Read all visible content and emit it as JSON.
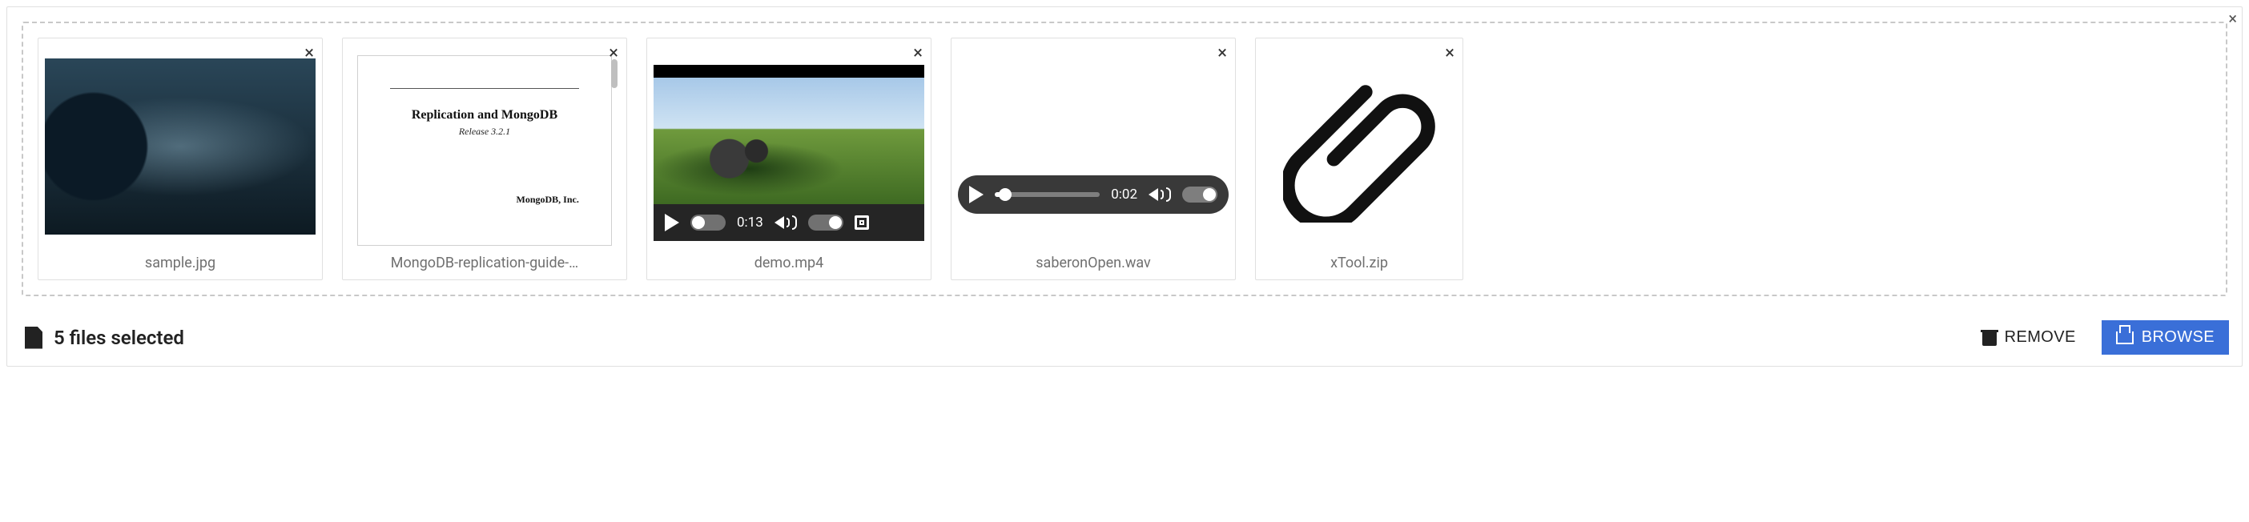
{
  "clear_all_glyph": "×",
  "card_close_glyph": "×",
  "files": [
    {
      "name": "sample.jpg",
      "kind": "image"
    },
    {
      "name": "MongoDB-replication-guide-…",
      "kind": "document",
      "doc": {
        "title": "Replication and MongoDB",
        "subtitle": "Release 3.2.1",
        "footer": "MongoDB, Inc."
      }
    },
    {
      "name": "demo.mp4",
      "kind": "video",
      "media": {
        "time": "0:13"
      }
    },
    {
      "name": "saberonOpen.wav",
      "kind": "audio",
      "media": {
        "time": "0:02"
      }
    },
    {
      "name": "xTool.zip",
      "kind": "attachment"
    }
  ],
  "footer": {
    "status": "5 files selected",
    "remove_label": "REMOVE",
    "browse_label": "BROWSE"
  }
}
